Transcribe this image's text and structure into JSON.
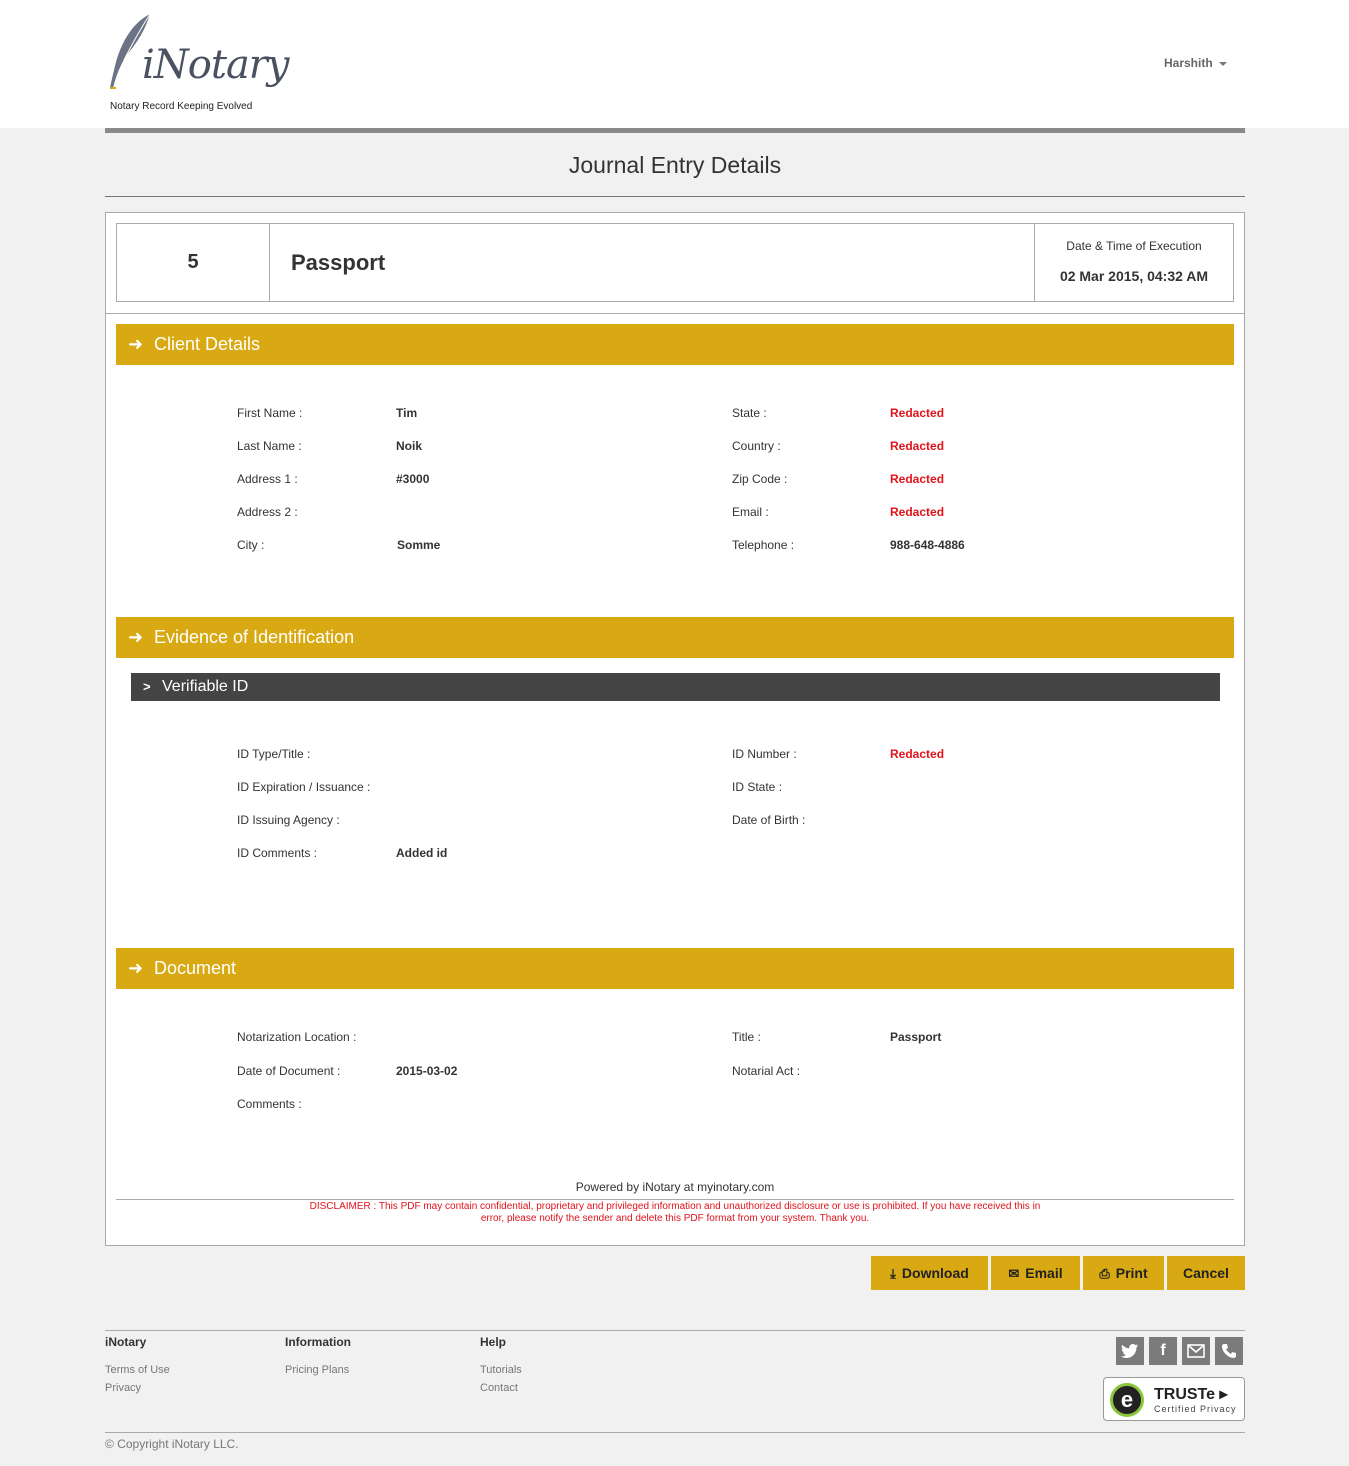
{
  "header": {
    "logo_text": "iNotary",
    "logo_tagline": "Notary Record Keeping Evolved",
    "user_name": "Harshith"
  },
  "page_title": "Journal Entry Details",
  "entry": {
    "number": "5",
    "document_type": "Passport",
    "date_label": "Date & Time of Execution",
    "date_value": "02 Mar 2015, 04:32 AM"
  },
  "client_details": {
    "title": "Client Details",
    "left": [
      {
        "label": "First Name :",
        "value": "Tim"
      },
      {
        "label": "Last Name :",
        "value": "Noik"
      },
      {
        "label": "Address 1 :",
        "value": "#3000"
      },
      {
        "label": "Address 2 :",
        "value": ""
      },
      {
        "label": "City :",
        "value": "Somme"
      }
    ],
    "right": [
      {
        "label": "State :",
        "value": "Redacted"
      },
      {
        "label": "Country :",
        "value": "Redacted"
      },
      {
        "label": "Zip Code :",
        "value": "Redacted"
      },
      {
        "label": "Email :",
        "value": "Redacted"
      },
      {
        "label": "Telephone :",
        "value": "988-648-4886"
      }
    ]
  },
  "evidence": {
    "title": "Evidence of Identification",
    "subsection": "Verifiable ID",
    "left": [
      {
        "label": "ID Type/Title :",
        "value": ""
      },
      {
        "label": "ID Expiration / Issuance :",
        "value": ""
      },
      {
        "label": "ID Issuing Agency :",
        "value": ""
      },
      {
        "label": "ID Comments :",
        "value": "Added id"
      }
    ],
    "right": [
      {
        "label": "ID Number :",
        "value": "Redacted"
      },
      {
        "label": "ID State :",
        "value": ""
      },
      {
        "label": "Date of Birth :",
        "value": ""
      }
    ]
  },
  "document": {
    "title": "Document",
    "left": [
      {
        "label": "Notarization Location :",
        "value": ""
      },
      {
        "label": "Date of Document :",
        "value": "2015-03-02"
      },
      {
        "label": "Comments :",
        "value": ""
      }
    ],
    "right": [
      {
        "label": "Title :",
        "value": "Passport"
      },
      {
        "label": "Notarial Act :",
        "value": ""
      }
    ]
  },
  "powered_by": "Powered by iNotary at myinotary.com",
  "disclaimer": "DISCLAIMER : This PDF may contain confidential, proprietary and privileged information and unauthorized disclosure or use is prohibited. If you have received this in error, please notify the sender and delete this PDF format from your system. Thank you.",
  "buttons": {
    "download": "Download",
    "email": "Email",
    "print": "Print",
    "cancel": "Cancel"
  },
  "footer": {
    "col1": {
      "heading": "iNotary",
      "links": [
        "Terms of Use",
        "Privacy"
      ]
    },
    "col2": {
      "heading": "Information",
      "links": [
        "Pricing Plans"
      ]
    },
    "col3": {
      "heading": "Help",
      "links": [
        "Tutorials",
        "Contact"
      ]
    },
    "social_icons": [
      "twitter-icon",
      "facebook-icon",
      "mail-icon",
      "phone-icon"
    ],
    "truste_title": "TRUSTe",
    "truste_sub": "Certified Privacy",
    "copyright": "© Copyright iNotary LLC."
  },
  "colors": {
    "accent": "#d8a912",
    "redacted": "#e1131b",
    "subsection_bar": "#444444"
  }
}
